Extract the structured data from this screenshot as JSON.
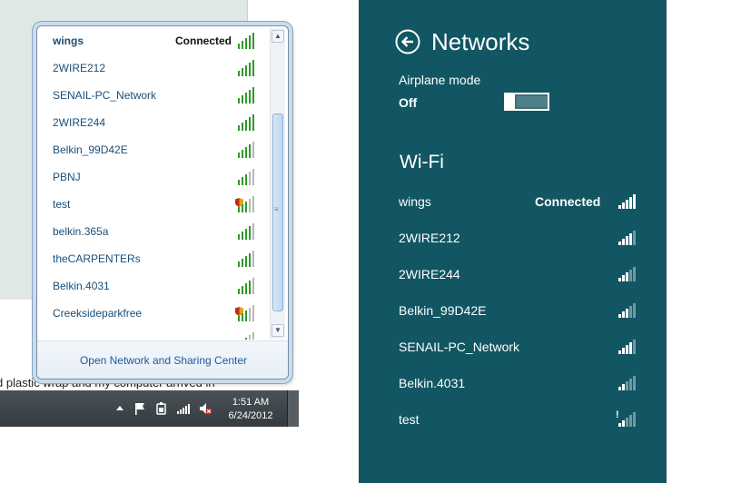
{
  "win7": {
    "background_text": "d plastic wrap and my computer arrived in",
    "networks": [
      {
        "name": "wings",
        "status": "Connected",
        "signal": 5,
        "secured_warning": false,
        "bold": true
      },
      {
        "name": "2WIRE212",
        "status": "",
        "signal": 5,
        "secured_warning": false,
        "bold": false
      },
      {
        "name": "SENAIL-PC_Network",
        "status": "",
        "signal": 5,
        "secured_warning": false,
        "bold": false
      },
      {
        "name": "2WIRE244",
        "status": "",
        "signal": 5,
        "secured_warning": false,
        "bold": false
      },
      {
        "name": "Belkin_99D42E",
        "status": "",
        "signal": 4,
        "secured_warning": false,
        "bold": false
      },
      {
        "name": "PBNJ",
        "status": "",
        "signal": 3,
        "secured_warning": false,
        "bold": false
      },
      {
        "name": "test",
        "status": "",
        "signal": 3,
        "secured_warning": true,
        "bold": false
      },
      {
        "name": "belkin.365a",
        "status": "",
        "signal": 4,
        "secured_warning": false,
        "bold": false
      },
      {
        "name": "theCARPENTERs",
        "status": "",
        "signal": 4,
        "secured_warning": false,
        "bold": false
      },
      {
        "name": "Belkin.4031",
        "status": "",
        "signal": 4,
        "secured_warning": false,
        "bold": false
      },
      {
        "name": "Creeksideparkfree",
        "status": "",
        "signal": 3,
        "secured_warning": true,
        "bold": false
      },
      {
        "name": "",
        "status": "",
        "signal": 3,
        "secured_warning": false,
        "bold": false
      }
    ],
    "footer_link": "Open Network and Sharing Center",
    "taskbar": {
      "time": "1:51 AM",
      "date": "6/24/2012",
      "icons": [
        "show-hidden-icons-arrow",
        "action-center-flag-icon",
        "power-icon",
        "network-signal-icon",
        "speaker-muted-icon"
      ]
    },
    "colors": {
      "signal_green": "#2f9a2a",
      "signal_gray": "#b7b7b7",
      "link_blue": "#1a4f7a"
    }
  },
  "win8": {
    "title": "Networks",
    "airplane_mode_label": "Airplane mode",
    "airplane_mode_value": "Off",
    "wifi_heading": "Wi-Fi",
    "networks": [
      {
        "name": "wings",
        "status": "Connected",
        "signal": 5,
        "secured_warning": false
      },
      {
        "name": "2WIRE212",
        "status": "",
        "signal": 4,
        "secured_warning": false
      },
      {
        "name": "2WIRE244",
        "status": "",
        "signal": 3,
        "secured_warning": false
      },
      {
        "name": "Belkin_99D42E",
        "status": "",
        "signal": 3,
        "secured_warning": false
      },
      {
        "name": "SENAIL-PC_Network",
        "status": "",
        "signal": 4,
        "secured_warning": false
      },
      {
        "name": "Belkin.4031",
        "status": "",
        "signal": 2,
        "secured_warning": false
      },
      {
        "name": "test",
        "status": "",
        "signal": 2,
        "secured_warning": true
      }
    ],
    "colors": {
      "background": "#115662",
      "bar_on": "#ffffff",
      "bar_off": "#6f9aa2"
    }
  }
}
